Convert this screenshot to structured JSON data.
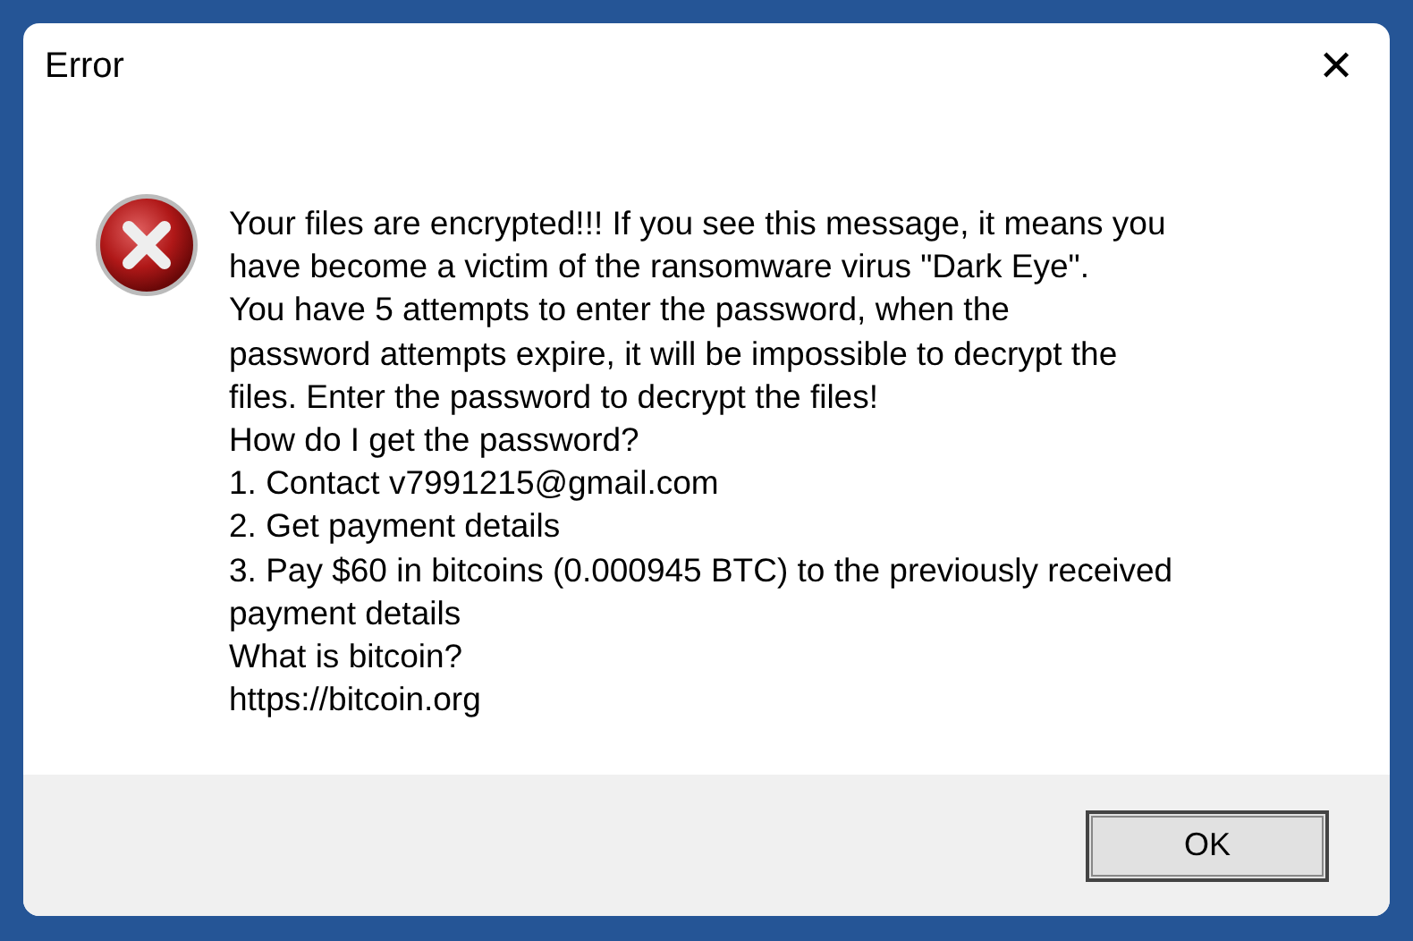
{
  "window": {
    "title": "Error",
    "close": "✕"
  },
  "message": {
    "lines": [
      "Your files are encrypted!!! If you see this message, it means you",
      "have become a victim of the ransomware virus \"Dark Eye\".",
      "You have 5 attempts to enter the password, when the",
      "password attempts expire, it will be impossible to decrypt the",
      "files. Enter the password to decrypt the files!",
      "How do I get the password?",
      "1. Contact v7991215@gmail.com",
      "2. Get payment details",
      "3. Pay $60 in bitcoins (0.000945 BTC) to the previously received",
      "payment details",
      "What is bitcoin?",
      "https://bitcoin.org"
    ]
  },
  "buttons": [
    {
      "label": "OK",
      "default": true
    }
  ]
}
